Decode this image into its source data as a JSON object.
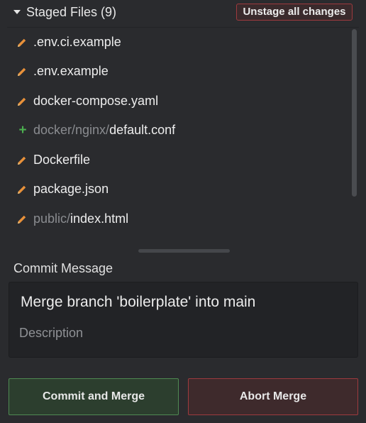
{
  "header": {
    "title": "Staged Files (9)",
    "unstage_label": "Unstage all changes"
  },
  "files": [
    {
      "status": "modified",
      "icon": "pencil-icon",
      "dir": "",
      "name": ".env.ci.example"
    },
    {
      "status": "modified",
      "icon": "pencil-icon",
      "dir": "",
      "name": ".env.example"
    },
    {
      "status": "modified",
      "icon": "pencil-icon",
      "dir": "",
      "name": "docker-compose.yaml"
    },
    {
      "status": "added",
      "icon": "plus-icon",
      "dir": "docker/nginx/",
      "name": "default.conf"
    },
    {
      "status": "modified",
      "icon": "pencil-icon",
      "dir": "",
      "name": "Dockerfile"
    },
    {
      "status": "modified",
      "icon": "pencil-icon",
      "dir": "",
      "name": "package.json"
    },
    {
      "status": "modified",
      "icon": "pencil-icon",
      "dir": "public/",
      "name": "index.html"
    }
  ],
  "commit": {
    "label": "Commit Message",
    "summary": "Merge branch 'boilerplate' into main",
    "description_placeholder": "Description"
  },
  "buttons": {
    "commit_label": "Commit and Merge",
    "abort_label": "Abort Merge"
  },
  "colors": {
    "modified": "#e8913a",
    "added": "#4caf50",
    "commit_border": "#4f8a52",
    "abort_border": "#9e3a3e"
  }
}
